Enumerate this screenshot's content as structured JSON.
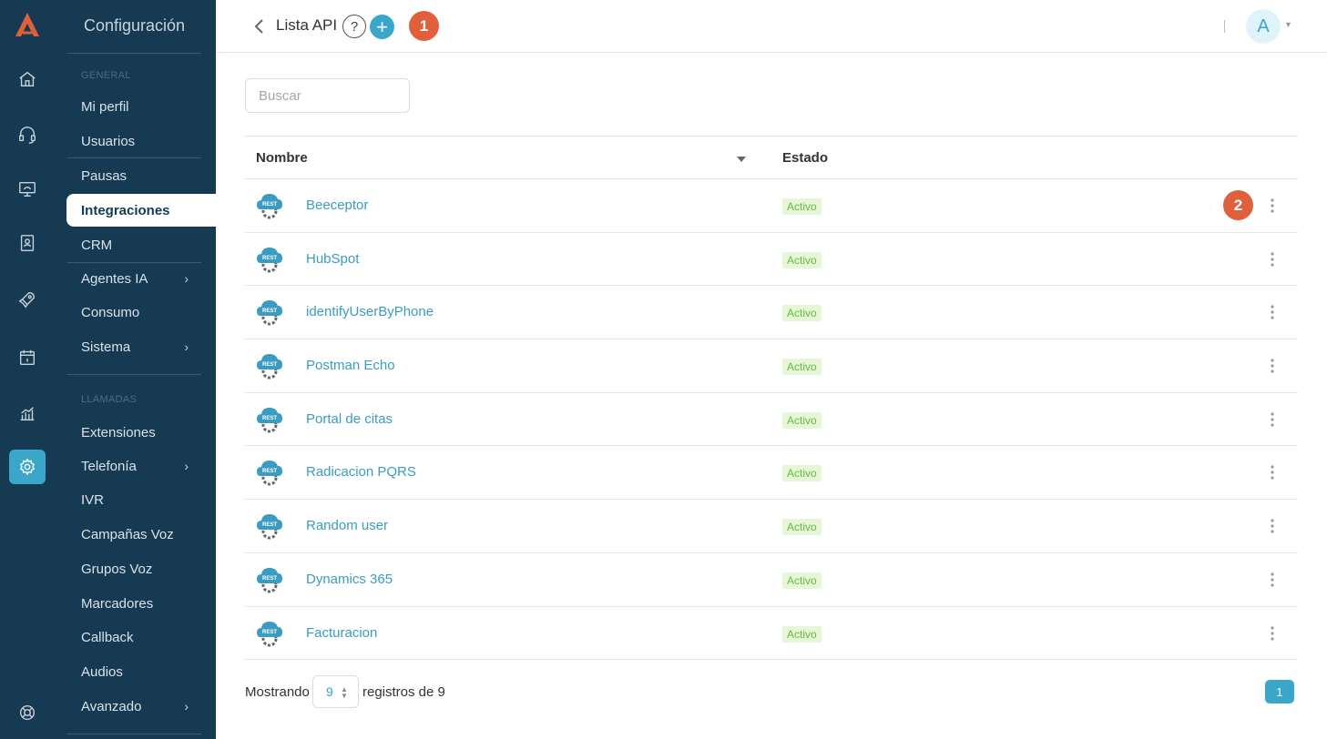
{
  "sidebar": {
    "title": "Configuración",
    "sections": [
      {
        "label": "GENERAL",
        "items": [
          {
            "label": "Mi perfil"
          },
          {
            "label": "Usuarios"
          },
          {
            "label": "Pausas"
          },
          {
            "label": "Integraciones"
          },
          {
            "label": "CRM"
          },
          {
            "label": "Agentes IA"
          },
          {
            "label": "Consumo"
          },
          {
            "label": "Sistema"
          }
        ]
      },
      {
        "label": "LLAMADAS",
        "items": [
          {
            "label": "Extensiones"
          },
          {
            "label": "Telefonía"
          },
          {
            "label": "IVR"
          },
          {
            "label": "Campañas Voz"
          },
          {
            "label": "Grupos Voz"
          },
          {
            "label": "Marcadores"
          },
          {
            "label": "Callback"
          },
          {
            "label": "Audios"
          },
          {
            "label": "Avanzado"
          }
        ]
      }
    ],
    "active": "Integraciones"
  },
  "header": {
    "title": "Lista API",
    "help_label": "?",
    "add_label": "+",
    "avatar_initial": "A"
  },
  "markers": {
    "first": "1",
    "second": "2"
  },
  "search": {
    "placeholder": "Buscar"
  },
  "table": {
    "columns": [
      "Nombre",
      "Estado"
    ],
    "rows": [
      {
        "name": "Beeceptor",
        "status": "Activo"
      },
      {
        "name": "HubSpot",
        "status": "Activo"
      },
      {
        "name": "identifyUserByPhone",
        "status": "Activo"
      },
      {
        "name": "Postman Echo",
        "status": "Activo"
      },
      {
        "name": "Portal de citas",
        "status": "Activo"
      },
      {
        "name": "Radicacion PQRS",
        "status": "Activo"
      },
      {
        "name": "Random user",
        "status": "Activo"
      },
      {
        "name": "Dynamics 365",
        "status": "Activo"
      },
      {
        "name": "Facturacion",
        "status": "Activo"
      }
    ],
    "rest_icon_label": "REST"
  },
  "footer": {
    "showing_label": "Mostrando",
    "page_size": "9",
    "records_label": "registros de 9",
    "current_page": "1"
  },
  "colors": {
    "sidebar_bg": "#163a52",
    "accent": "#3aa6c9",
    "marker": "#e0603c",
    "badge_bg": "#e6f7d9",
    "badge_text": "#68b93a"
  }
}
